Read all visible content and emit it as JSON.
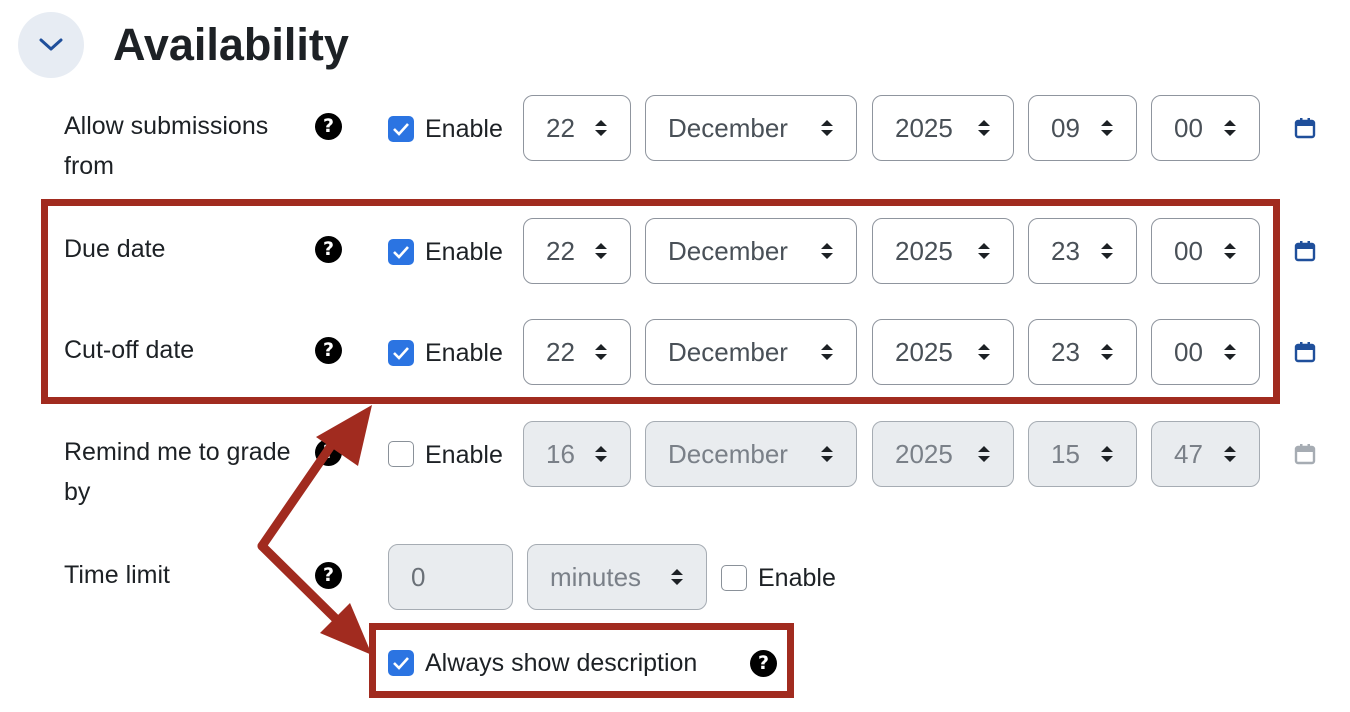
{
  "section": {
    "title": "Availability"
  },
  "enable_label": "Enable",
  "rows": [
    {
      "label": "Allow submissions from",
      "enabled": true,
      "day": "22",
      "month": "December",
      "year": "2025",
      "hour": "09",
      "minute": "00"
    },
    {
      "label": "Due date",
      "enabled": true,
      "day": "22",
      "month": "December",
      "year": "2025",
      "hour": "23",
      "minute": "00"
    },
    {
      "label": "Cut-off date",
      "enabled": true,
      "day": "22",
      "month": "December",
      "year": "2025",
      "hour": "23",
      "minute": "00"
    },
    {
      "label": "Remind me to grade by",
      "enabled": false,
      "day": "16",
      "month": "December",
      "year": "2025",
      "hour": "15",
      "minute": "47"
    }
  ],
  "time_limit": {
    "label": "Time limit",
    "value": "0",
    "unit": "minutes",
    "enable_label": "Enable",
    "enabled": false
  },
  "always_show": {
    "label": "Always show description",
    "checked": true
  },
  "colors": {
    "accent": "#2b74e2",
    "highlight": "#a12b1f",
    "disabled_bg": "#e9ecef"
  }
}
